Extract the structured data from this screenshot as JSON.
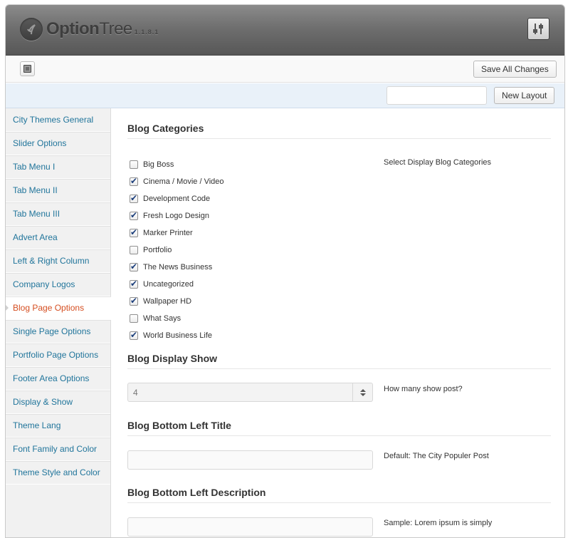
{
  "header": {
    "logo_bold": "Option",
    "logo_light": "Tree",
    "version": "1.1.8.1",
    "settings_icon": "sliders-icon"
  },
  "toolbar": {
    "save_label": "Save All Changes",
    "toggle_icon": "window-icon"
  },
  "layouts": {
    "input_value": "",
    "new_layout_label": "New Layout"
  },
  "sidebar": {
    "active_index": 8,
    "items": [
      {
        "label": "City Themes General"
      },
      {
        "label": "Slider Options"
      },
      {
        "label": "Tab Menu I"
      },
      {
        "label": "Tab Menu II"
      },
      {
        "label": "Tab Menu III"
      },
      {
        "label": "Advert Area"
      },
      {
        "label": "Left & Right Column"
      },
      {
        "label": "Company Logos"
      },
      {
        "label": "Blog Page Options"
      },
      {
        "label": "Single Page Options"
      },
      {
        "label": "Portfolio Page Options"
      },
      {
        "label": "Footer Area Options"
      },
      {
        "label": "Display & Show"
      },
      {
        "label": "Theme Lang"
      },
      {
        "label": "Font Family and Color"
      },
      {
        "label": "Theme Style and Color"
      }
    ]
  },
  "sections": {
    "blog_categories": {
      "title": "Blog Categories",
      "description": "Select Display Blog Categories",
      "options": [
        {
          "label": "Big Boss",
          "checked": false
        },
        {
          "label": "Cinema / Movie / Video",
          "checked": true
        },
        {
          "label": "Development Code",
          "checked": true
        },
        {
          "label": "Fresh Logo Design",
          "checked": true
        },
        {
          "label": "Marker Printer",
          "checked": true
        },
        {
          "label": "Portfolio",
          "checked": false
        },
        {
          "label": "The News Business",
          "checked": true
        },
        {
          "label": "Uncategorized",
          "checked": true
        },
        {
          "label": "Wallpaper HD",
          "checked": true
        },
        {
          "label": "What Says",
          "checked": false
        },
        {
          "label": "World Business Life",
          "checked": true
        }
      ]
    },
    "display_show": {
      "title": "Blog Display Show",
      "value": "4",
      "description": "How many show post?"
    },
    "bottom_left_title": {
      "title": "Blog Bottom Left Title",
      "value": "",
      "description": "Default: The City Populer Post"
    },
    "bottom_left_description": {
      "title": "Blog Bottom Left Description",
      "value": "",
      "description": "Sample: Lorem ipsum is simply"
    }
  },
  "colors": {
    "link": "#21759b",
    "active_link": "#d54e21",
    "check": "#1b3e7a"
  }
}
